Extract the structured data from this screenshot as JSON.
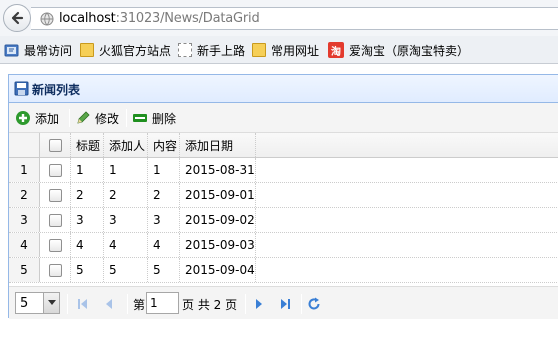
{
  "browser": {
    "url_host": "localhost",
    "url_rest": ":31023/News/DataGrid",
    "bookmarks": [
      {
        "label": "最常访问",
        "icon": "bookmarks-menu-icon"
      },
      {
        "label": "火狐官方站点",
        "icon": "folder-icon"
      },
      {
        "label": "新手上路",
        "icon": "dashed-page-icon"
      },
      {
        "label": "常用网址",
        "icon": "folder-icon"
      },
      {
        "label": "爱淘宝（原淘宝特卖）",
        "icon": "taobao-icon",
        "icon_text": "淘"
      }
    ]
  },
  "panel": {
    "title": "新闻列表",
    "toolbar": {
      "add": "添加",
      "edit": "修改",
      "delete": "删除"
    },
    "columns": [
      "标题",
      "添加人",
      "内容",
      "添加日期"
    ],
    "rows": [
      {
        "num": "1",
        "title": "1",
        "author": "1",
        "content": "1",
        "date": "2015-08-31"
      },
      {
        "num": "2",
        "title": "2",
        "author": "2",
        "content": "2",
        "date": "2015-09-01"
      },
      {
        "num": "3",
        "title": "3",
        "author": "3",
        "content": "3",
        "date": "2015-09-02"
      },
      {
        "num": "4",
        "title": "4",
        "author": "4",
        "content": "4",
        "date": "2015-09-03"
      },
      {
        "num": "5",
        "title": "5",
        "author": "5",
        "content": "5",
        "date": "2015-09-04"
      }
    ],
    "pager": {
      "page_size": "5",
      "page_prefix": "第",
      "page_value": "1",
      "page_suffix": "页 共 2 页"
    }
  },
  "colors": {
    "panel_border": "#95b8e7",
    "header_bg": "#e0ecff",
    "pager_icon": "#3a7fd5",
    "add_icon": "#2e9a2e",
    "delete_icon": "#1f8f1f"
  }
}
